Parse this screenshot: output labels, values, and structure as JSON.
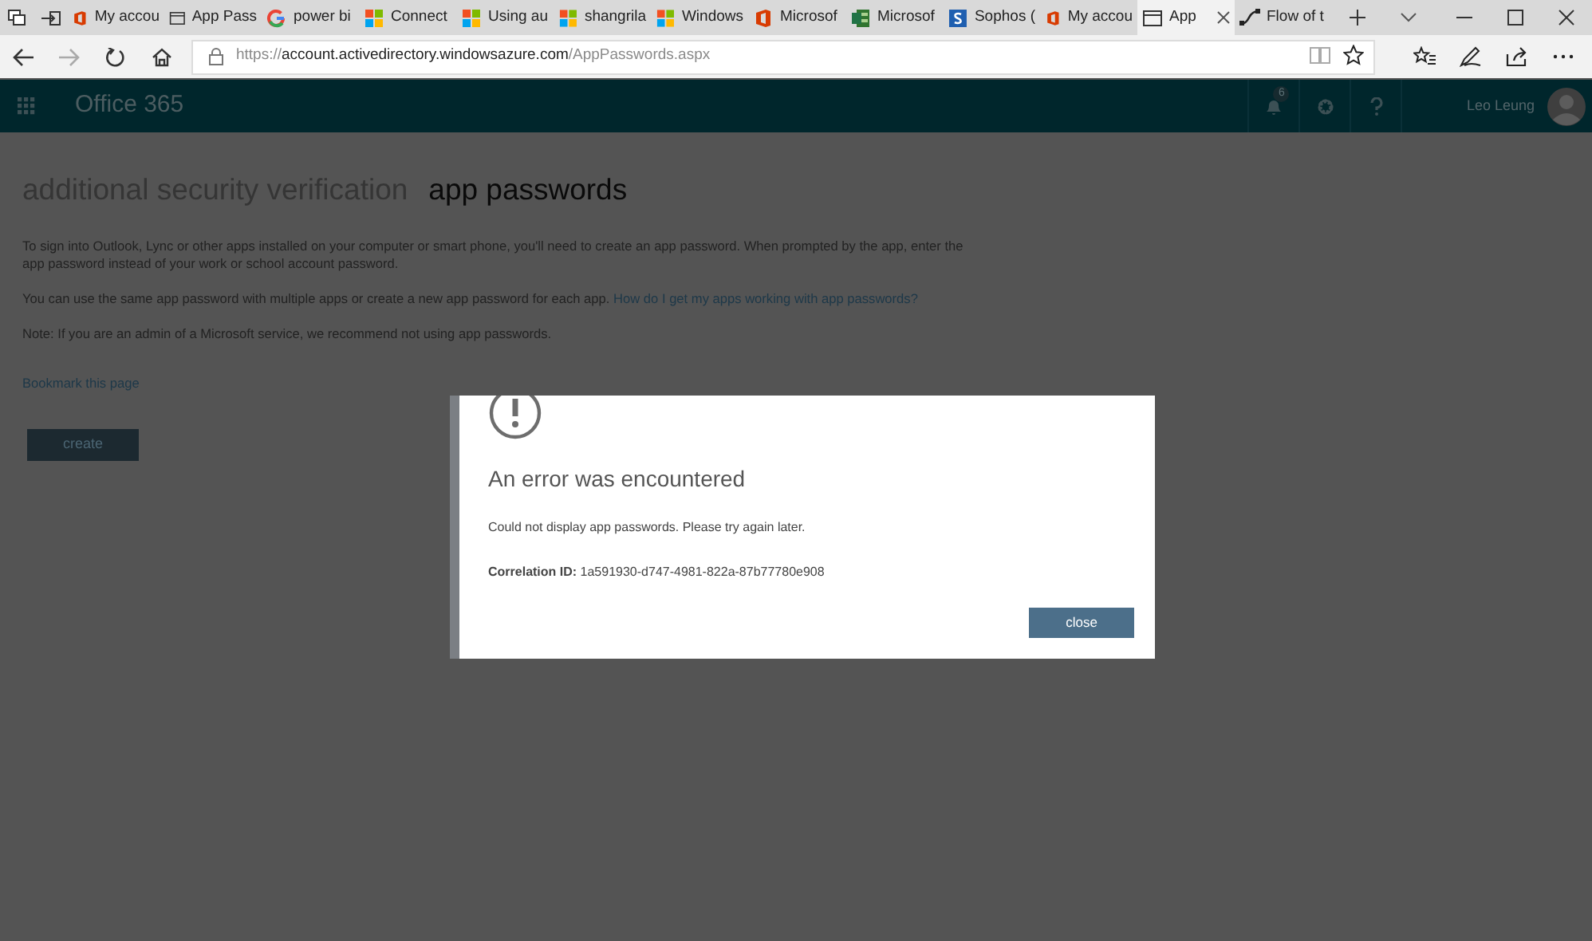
{
  "browser": {
    "tabs": [
      {
        "kind": "office",
        "label": "My accou",
        "selected": false
      },
      {
        "kind": "page",
        "label": "App Pass",
        "selected": false
      },
      {
        "kind": "google",
        "label": "power bi",
        "selected": false
      },
      {
        "kind": "windows",
        "label": "Connect",
        "selected": false
      },
      {
        "kind": "windows",
        "label": "Using au",
        "selected": false
      },
      {
        "kind": "windows",
        "label": "shangrila",
        "selected": false
      },
      {
        "kind": "windows",
        "label": "Windows",
        "selected": false
      },
      {
        "kind": "office",
        "label": "Microsof",
        "selected": false
      },
      {
        "kind": "sheet",
        "label": "Microsof",
        "selected": false
      },
      {
        "kind": "sophos",
        "label": "Sophos (",
        "selected": false
      },
      {
        "kind": "office",
        "label": "My accou",
        "selected": false
      },
      {
        "kind": "page",
        "label": "App",
        "selected": true
      },
      {
        "kind": "flow",
        "label": "Flow of t",
        "selected": false
      }
    ],
    "address": {
      "scheme": "https://",
      "host": "account.activedirectory.windowsazure.com",
      "path": "/AppPasswords.aspx"
    }
  },
  "header": {
    "title": "Office 365",
    "notification_count": "6",
    "user_name": "Leo Leung"
  },
  "page": {
    "headings": [
      {
        "label": "additional security verification",
        "selected": false
      },
      {
        "label": "app passwords",
        "selected": true
      }
    ],
    "paragraphs": [
      {
        "text": "To sign into Outlook, Lync or other apps installed on your computer or smart phone, you'll need to create an app password. When prompted by the app, enter the app password instead of your work or school account password."
      },
      {
        "text": "You can use the same app password with multiple apps or create a new app password for each app.",
        "link": "How do I get my apps working with app passwords?"
      },
      {
        "text": "Note: If you are an admin of a Microsoft service, we recommend not using app passwords."
      }
    ],
    "bookmark_link": "Bookmark this page",
    "create_button": "create"
  },
  "dialog": {
    "title": "An error was encountered",
    "message": "Could not display app passwords. Please try again later.",
    "correlation": "**Correlation ID:** 1a591930-d747-4981-822a-87b77780e908",
    "close_button": "close"
  }
}
